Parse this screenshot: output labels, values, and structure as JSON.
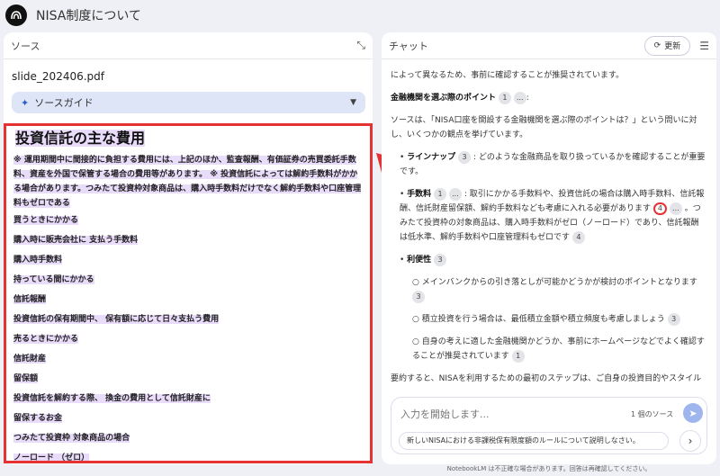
{
  "app": {
    "title": "NISA制度について"
  },
  "source_panel": {
    "header": "ソース",
    "filename": "slide_202406.pdf",
    "guide_label": "ソースガイド",
    "content": {
      "heading": "投資信託の主な費用",
      "paragraph": "※ 運用期間中に間接的に負担する費用には、上記のほか、監査報酬、有価証券の売買委託手数料、資産を外国で保管する場合の費用等があります。 ※ 投資信託によっては解約手数料がかかる場合があります。つみたて投資枠対象商品は、購入時手数料だけでなく解約手数料や口座管理料もゼロである",
      "items": [
        "買うときにかかる",
        "購入時に販売会社に 支払う手数料",
        "購入時手数料",
        "持っている間にかかる",
        "信託報酬",
        "投資信託の保有期間中、 保有額に応じて日々支払う費用",
        "売るときにかかる",
        "信託財産",
        "留保額",
        "投資信託を解約する際、 換金の費用として信託財産に",
        "留保するお金",
        "つみたて投資枠 対象商品の場合",
        "ノーロード （ゼロ）"
      ]
    }
  },
  "chat_panel": {
    "header": "チャット",
    "refresh_label": "更新",
    "messages": {
      "line1": "によって異なるため、事前に確認することが推奨されています。",
      "section_title": "金融機関を選ぶ際のポイント",
      "section_title_suffix": ":",
      "intro": "ソースは、「NISA口座を開設する金融機関を選ぶ際のポイントは？」という問いに対し、いくつかの観点を挙げています。",
      "lineup_title": "ラインナップ",
      "lineup_text": ": どのような金融商品を取り扱っているかを確認することが重要です。",
      "fees_title": "手数料",
      "fees_text_a": ": 取引にかかる手数料や、投資信託の場合は購入時手数料、信託報酬、信託財産留保額、解約手数料なども考慮に入れる必要があります",
      "fees_text_b": "。つみたて投資枠の対象商品は、購入時手数料がゼロ（ノーロード）であり、信託報酬は低水準、解約手数料や口座管理料もゼロです",
      "convenience_title": "利便性",
      "sub1": "メインバンクからの引き落としが可能かどうかが検討のポイントとなります",
      "sub2": "積立投資を行う場合は、最低積立金額や積立頻度も考慮しましょう",
      "sub3": "自身の考えに適した金融機関かどうか、事前にホームページなどでよく確認することが推奨されています",
      "summary": "要約すると、NISAを利用するための最初のステップは、ご自身の投資目的やスタイルに合った金融機関を選び、そこでNISA口座を開設することです。"
    },
    "badges": {
      "b1": "1",
      "b3": "3",
      "b4": "4",
      "b1b": "1",
      "ellipsis": "..."
    },
    "input": {
      "placeholder": "入力を開始します...",
      "source_count": "1 個のソース",
      "suggestion": "新しいNISAにおける非課税保有限度額のルールについて説明しなさい。"
    }
  },
  "footer": "NotebookLM は不正確な場合があります。回答は再確認してください。",
  "colors": {
    "highlight": "#e53232",
    "accent": "#2b5fc7",
    "source_highlight": "#e9dcfa"
  },
  "icons": [
    "logo-icon",
    "collapse-icon",
    "sparkle-icon",
    "chevron-down-icon",
    "refresh-icon",
    "tune-icon",
    "send-icon",
    "chevron-right-icon"
  ]
}
